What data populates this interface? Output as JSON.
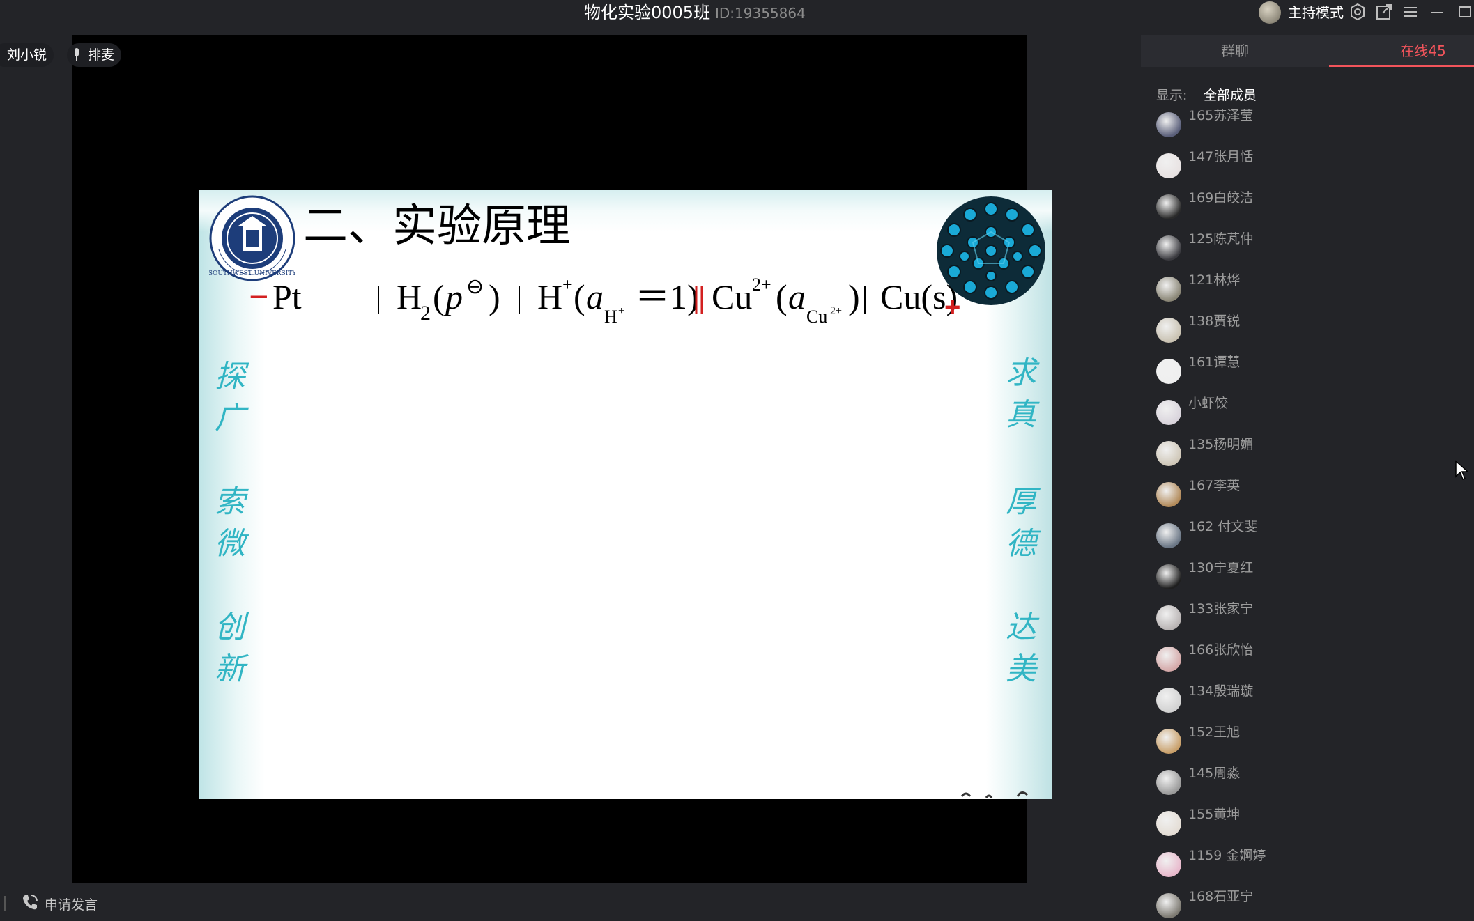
{
  "window": {
    "title": "物化实验0005班",
    "id_text": "ID:19355864",
    "host_mode": "主持模式"
  },
  "overlay": {
    "user_name": "刘小锐",
    "mic_queue_label": "排麦"
  },
  "slide": {
    "title": "二、实验原理",
    "logo_text": "SOUTHWEST UNIVERSITY",
    "formula": {
      "minus_sign": "−",
      "plus_sign": "+",
      "pt": "Pt",
      "h": "H",
      "two": "2",
      "p": "p",
      "theta": "⊖",
      "hplus": "H",
      "plus_sup": "+",
      "a": "a",
      "eq_one": "＝1)",
      "cu": "Cu",
      "cu_charge": "2+",
      "cus": "Cu(s)"
    },
    "motto_left": [
      "探",
      "广",
      "索",
      "微",
      "创",
      "新"
    ],
    "motto_right": [
      "求",
      "真",
      "厚",
      "德",
      "达",
      "美"
    ]
  },
  "panel": {
    "tab_chat": "群聊",
    "tab_online": "在线45",
    "filter_label": "显示:",
    "filter_value": "全部成员",
    "members": [
      {
        "name": "165苏泽莹",
        "avatar_color": "#5a5f7a"
      },
      {
        "name": "147张月恬",
        "avatar_color": "#e8e2e2"
      },
      {
        "name": "169白皎洁",
        "avatar_color": "#2a2a2a"
      },
      {
        "name": "125陈芃仲",
        "avatar_color": "#3a3a3f"
      },
      {
        "name": "121林烨",
        "avatar_color": "#8a8676"
      },
      {
        "name": "138贾锐",
        "avatar_color": "#c9c2b2"
      },
      {
        "name": "161谭慧",
        "avatar_color": "#efefef"
      },
      {
        "name": "小虾饺",
        "avatar_color": "#d9d4dc"
      },
      {
        "name": "135杨明媚",
        "avatar_color": "#cfc7b8"
      },
      {
        "name": "167李英",
        "avatar_color": "#b28a5a"
      },
      {
        "name": "162 付文斐",
        "avatar_color": "#6a7685"
      },
      {
        "name": "130宁夏红",
        "avatar_color": "#1f1f1f"
      },
      {
        "name": "133张家宁",
        "avatar_color": "#b9b4b4"
      },
      {
        "name": "166张欣怡",
        "avatar_color": "#d5a9a9"
      },
      {
        "name": "134殷瑞璇",
        "avatar_color": "#d2d2d2"
      },
      {
        "name": "152王旭",
        "avatar_color": "#c9a06a"
      },
      {
        "name": "145周淼",
        "avatar_color": "#9a9a9a"
      },
      {
        "name": "155黄坤",
        "avatar_color": "#e4ddd5"
      },
      {
        "name": "1159 金婀婷",
        "avatar_color": "#e8b9cc"
      },
      {
        "name": "168石亚宁",
        "avatar_color": "#7d7a72"
      }
    ]
  },
  "bottom": {
    "speak_request": "申请发言"
  },
  "colors": {
    "accent_red": "#f2545b",
    "motto_teal": "#31b5c4",
    "slide_red": "#d32020"
  }
}
